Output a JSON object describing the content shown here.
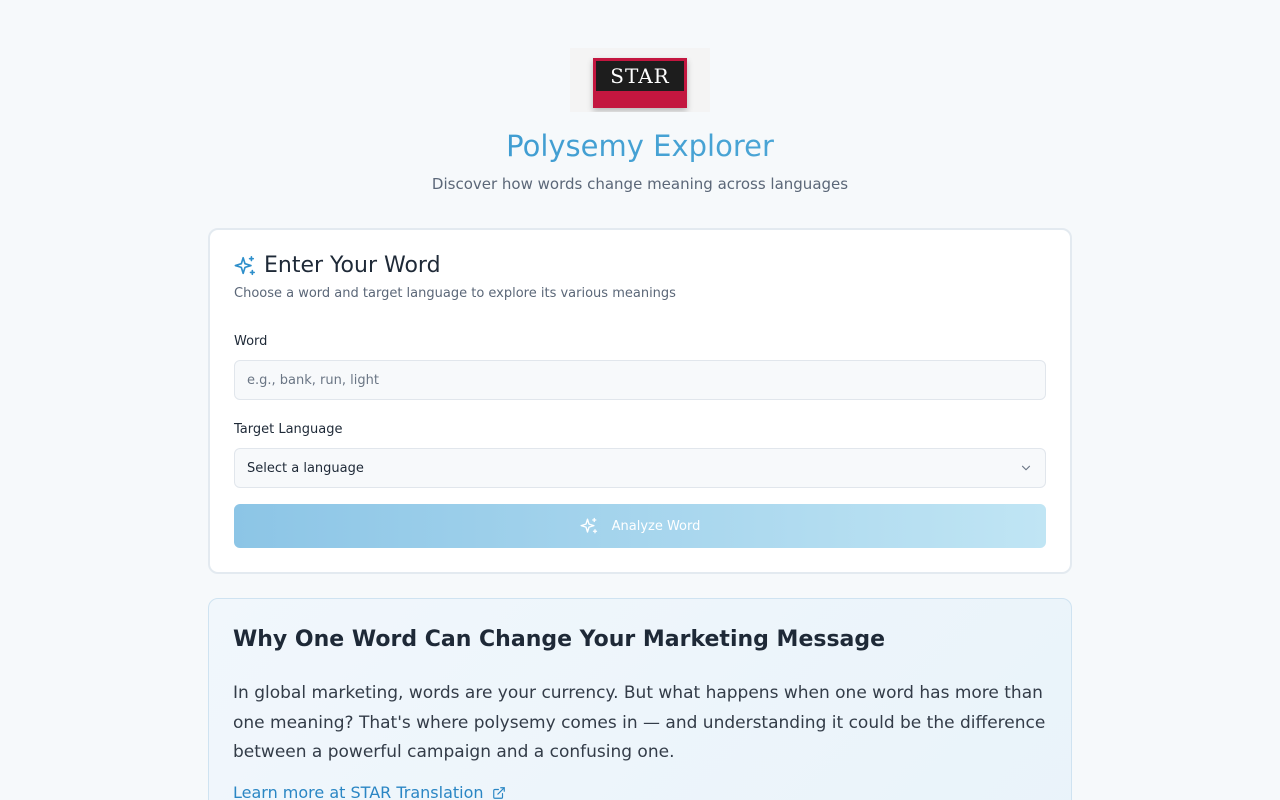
{
  "logo": {
    "text": "STAR",
    "colors": {
      "frame": "#c3163f",
      "plate": "#1d1d1d"
    }
  },
  "header": {
    "title": "Polysemy Explorer",
    "subtitle": "Discover how words change meaning across languages"
  },
  "form": {
    "icon": "sparkles-icon",
    "title": "Enter Your Word",
    "description": "Choose a word and target language to explore its various meanings",
    "word_label": "Word",
    "word_value": "",
    "word_placeholder": "e.g., bank, run, light",
    "language_label": "Target Language",
    "language_selected": "Select a language",
    "submit_label": "Analyze Word",
    "submit_disabled": true
  },
  "info": {
    "title": "Why One Word Can Change Your Marketing Message",
    "body": "In global marketing, words are your currency. But what happens when one word has more than one meaning? That's where polysemy comes in — and understanding it could be the difference between a powerful campaign and a confusing one.",
    "link_text": "Learn more at STAR Translation"
  },
  "colors": {
    "accent": "#2e8fcb",
    "accent_light": "#5cb3dc",
    "link": "#2a86c4",
    "background": "#f6f9fb"
  }
}
